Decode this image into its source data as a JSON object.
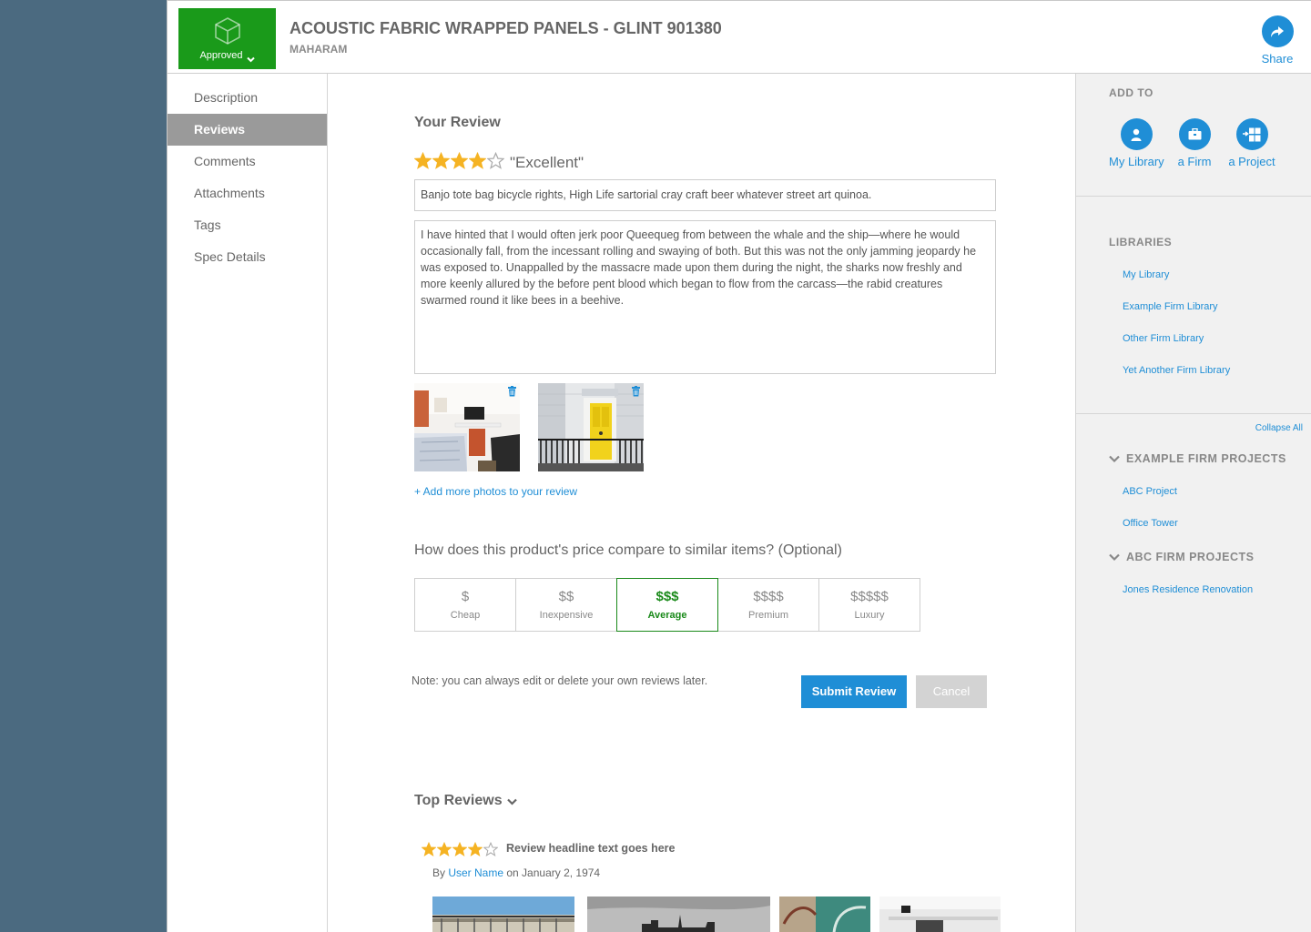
{
  "header": {
    "badge_label": "Approved",
    "title": "ACOUSTIC FABRIC WRAPPED PANELS - GLINT 901380",
    "subtitle": "MAHARAM",
    "share_label": "Share"
  },
  "nav": {
    "items": [
      {
        "label": "Description",
        "active": false
      },
      {
        "label": "Reviews",
        "active": true
      },
      {
        "label": "Comments",
        "active": false
      },
      {
        "label": "Attachments",
        "active": false
      },
      {
        "label": "Tags",
        "active": false
      },
      {
        "label": "Spec Details",
        "active": false
      }
    ]
  },
  "review": {
    "heading": "Your Review",
    "rating": 4,
    "rating_max": 5,
    "rating_text": "\"Excellent\"",
    "headline_value": "Banjo tote bag bicycle rights, High Life sartorial cray craft beer whatever street art quinoa.",
    "body_value": "I have hinted that I would often jerk poor Queequeg from between the whale and the ship—where he would occasionally fall, from the incessant rolling and swaying of both. But this was not the only jamming jeopardy he was exposed to. Unappalled by the massacre made upon them during the night, the sharks now freshly and more keenly allured by the before pent blood which began to flow from the carcass—the rabid creatures swarmed round it like bees in a beehive.",
    "add_photos_label": "+ Add more photos to your review",
    "price_question": "How does this product's price compare to similar items? (Optional)",
    "price_options": [
      {
        "symbol": "$",
        "name": "Cheap"
      },
      {
        "symbol": "$$",
        "name": "Inexpensive"
      },
      {
        "symbol": "$$$",
        "name": "Average"
      },
      {
        "symbol": "$$$$",
        "name": "Premium"
      },
      {
        "symbol": "$$$$$",
        "name": "Luxury"
      }
    ],
    "price_selected": "Average",
    "note": "Note: you can always edit or delete your own reviews later.",
    "submit_label": "Submit Review",
    "cancel_label": "Cancel"
  },
  "top_reviews": {
    "heading": "Top Reviews",
    "first": {
      "rating": 4,
      "headline": "Review headline text goes here",
      "by_prefix": "By ",
      "user": "User Name",
      "date_text": " on January 2, 1974"
    }
  },
  "sidebar": {
    "add_to_heading": "ADD TO",
    "add_to": [
      {
        "label": "My Library",
        "icon": "user-icon"
      },
      {
        "label": "a Firm",
        "icon": "briefcase-icon"
      },
      {
        "label": "a Project",
        "icon": "add-to-project-icon"
      }
    ],
    "libraries_heading": "LIBRARIES",
    "libraries": [
      "My Library",
      "Example Firm Library",
      "Other Firm Library",
      "Yet Another Firm Library"
    ],
    "collapse_label": "Collapse All",
    "project_groups": [
      {
        "heading": "EXAMPLE FIRM PROJECTS",
        "projects": [
          "ABC Project",
          "Office Tower"
        ]
      },
      {
        "heading": "ABC FIRM PROJECTS",
        "projects": [
          "Jones Residence Renovation"
        ]
      }
    ]
  },
  "colors": {
    "accent": "#1f8ed6",
    "approved_green": "#1a9a1a",
    "star": "#f5b323",
    "page_bg": "#4b6a80"
  }
}
